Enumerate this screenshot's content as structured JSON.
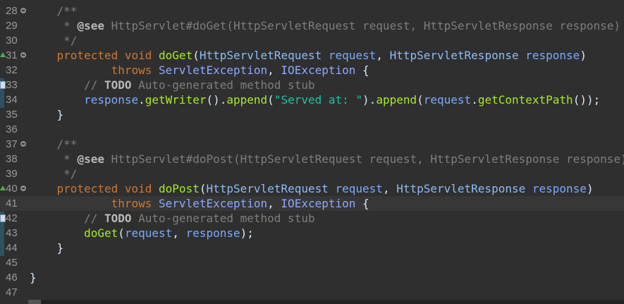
{
  "editor": {
    "lines": [
      {
        "n": "28",
        "fold": true,
        "marker": "",
        "current": false,
        "tokens": [
          [
            "    /**",
            "comment"
          ]
        ]
      },
      {
        "n": "29",
        "fold": false,
        "marker": "",
        "current": false,
        "tokens": [
          [
            "     * ",
            "comment"
          ],
          [
            "@see",
            "tag"
          ],
          [
            " HttpServlet#doGet(HttpServletRequest request, HttpServletResponse response)",
            "comment"
          ]
        ]
      },
      {
        "n": "30",
        "fold": false,
        "marker": "",
        "current": false,
        "tokens": [
          [
            "     */",
            "comment"
          ]
        ]
      },
      {
        "n": "31",
        "fold": true,
        "marker": "override",
        "current": false,
        "tokens": [
          [
            "    protected void ",
            "kw"
          ],
          [
            "doGet",
            "method"
          ],
          [
            "(",
            "plain"
          ],
          [
            "HttpServletRequest",
            "type"
          ],
          [
            " ",
            "plain"
          ],
          [
            "request",
            "param"
          ],
          [
            ", ",
            "plain"
          ],
          [
            "HttpServletResponse",
            "type"
          ],
          [
            " ",
            "plain"
          ],
          [
            "response",
            "param"
          ],
          [
            ")",
            "plain"
          ]
        ]
      },
      {
        "n": "32",
        "fold": false,
        "marker": "",
        "current": false,
        "tokens": [
          [
            "            throws ",
            "kw"
          ],
          [
            "ServletException",
            "ident"
          ],
          [
            ", ",
            "plain"
          ],
          [
            "IOException",
            "ident"
          ],
          [
            " {",
            "plain"
          ]
        ]
      },
      {
        "n": "33",
        "fold": false,
        "marker": "task",
        "current": false,
        "tokens": [
          [
            "        // ",
            "comment"
          ],
          [
            "TODO",
            "tag"
          ],
          [
            " Auto-generated method stub",
            "comment"
          ]
        ]
      },
      {
        "n": "34",
        "fold": false,
        "marker": "",
        "current": false,
        "tokens": [
          [
            "        ",
            "plain"
          ],
          [
            "response",
            "param"
          ],
          [
            ".",
            "plain"
          ],
          [
            "getWriter",
            "method"
          ],
          [
            "().",
            "plain"
          ],
          [
            "append",
            "method"
          ],
          [
            "(",
            "plain"
          ],
          [
            "\"Served at: \"",
            "string"
          ],
          [
            ").",
            "plain"
          ],
          [
            "append",
            "method"
          ],
          [
            "(",
            "plain"
          ],
          [
            "request",
            "param"
          ],
          [
            ".",
            "plain"
          ],
          [
            "getContextPath",
            "method"
          ],
          [
            "());",
            "plain"
          ]
        ]
      },
      {
        "n": "35",
        "fold": false,
        "marker": "",
        "current": false,
        "tokens": [
          [
            "    }",
            "plain"
          ]
        ]
      },
      {
        "n": "36",
        "fold": false,
        "marker": "",
        "current": false,
        "tokens": []
      },
      {
        "n": "37",
        "fold": true,
        "marker": "",
        "current": false,
        "tokens": [
          [
            "    /**",
            "comment"
          ]
        ]
      },
      {
        "n": "38",
        "fold": false,
        "marker": "",
        "current": false,
        "tokens": [
          [
            "     * ",
            "comment"
          ],
          [
            "@see",
            "tag"
          ],
          [
            " HttpServlet#doPost(HttpServletRequest request, HttpServletResponse response)",
            "comment"
          ]
        ]
      },
      {
        "n": "39",
        "fold": false,
        "marker": "",
        "current": false,
        "tokens": [
          [
            "     */",
            "comment"
          ]
        ]
      },
      {
        "n": "40",
        "fold": true,
        "marker": "override",
        "current": false,
        "tokens": [
          [
            "    protected void ",
            "kw"
          ],
          [
            "doPost",
            "method"
          ],
          [
            "(",
            "plain"
          ],
          [
            "HttpServletRequest",
            "type"
          ],
          [
            " ",
            "plain"
          ],
          [
            "request",
            "param"
          ],
          [
            ", ",
            "plain"
          ],
          [
            "HttpServletResponse",
            "type"
          ],
          [
            " ",
            "plain"
          ],
          [
            "response",
            "param"
          ],
          [
            ")",
            "plain"
          ]
        ]
      },
      {
        "n": "41",
        "fold": false,
        "marker": "",
        "current": true,
        "tokens": [
          [
            "            throws ",
            "kw"
          ],
          [
            "ServletException",
            "ident"
          ],
          [
            ", ",
            "plain"
          ],
          [
            "IOException",
            "ident"
          ],
          [
            " {",
            "plain"
          ]
        ]
      },
      {
        "n": "42",
        "fold": false,
        "marker": "task",
        "current": false,
        "tokens": [
          [
            "        // ",
            "comment"
          ],
          [
            "TODO",
            "tag"
          ],
          [
            " Auto-generated method stub",
            "comment"
          ]
        ]
      },
      {
        "n": "43",
        "fold": false,
        "marker": "",
        "current": false,
        "tokens": [
          [
            "        ",
            "plain"
          ],
          [
            "doGet",
            "method"
          ],
          [
            "(",
            "plain"
          ],
          [
            "request",
            "param"
          ],
          [
            ", ",
            "plain"
          ],
          [
            "response",
            "param"
          ],
          [
            ");",
            "plain"
          ]
        ]
      },
      {
        "n": "44",
        "fold": false,
        "marker": "",
        "current": false,
        "tokens": [
          [
            "    }",
            "plain"
          ]
        ]
      },
      {
        "n": "45",
        "fold": false,
        "marker": "",
        "current": false,
        "tokens": []
      },
      {
        "n": "46",
        "fold": false,
        "marker": "",
        "current": false,
        "tokens": [
          [
            "}",
            "plain"
          ]
        ]
      },
      {
        "n": "47",
        "fold": false,
        "marker": "",
        "current": false,
        "tokens": []
      }
    ]
  },
  "icons": {
    "fold": "fold-collapse-icon",
    "override": "override-marker-icon",
    "task": "task-marker-icon"
  },
  "colors": {
    "background": "#2f2f2f",
    "current_line": "#373737",
    "keyword": "#cc7832",
    "method": "#a7ec21",
    "type": "#8cbef6",
    "string": "#17c6a3",
    "comment": "#7e7e7e"
  }
}
